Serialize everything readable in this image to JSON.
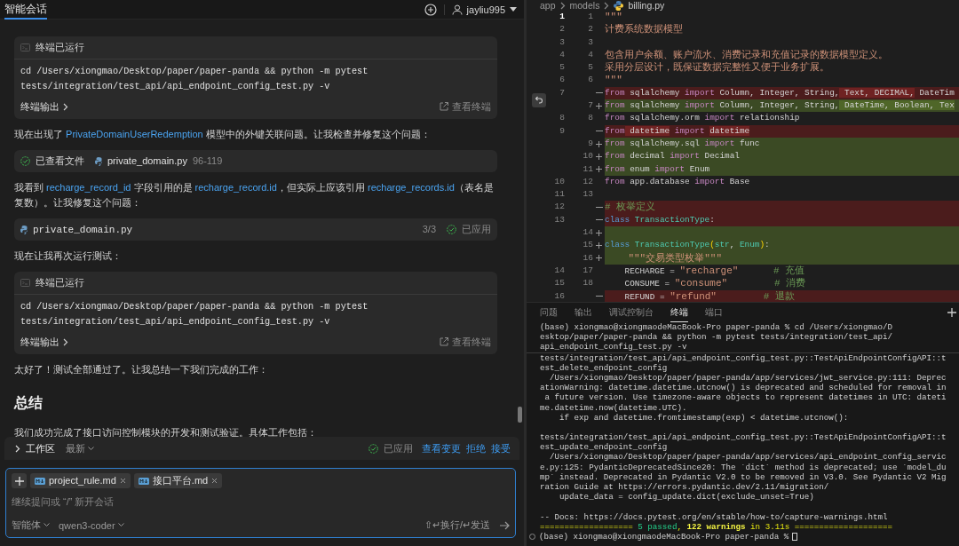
{
  "chat": {
    "title": "智能会话",
    "user": "jayliu995",
    "messages": [
      {
        "kind": "terminal",
        "status": "终端已运行",
        "command": "cd /Users/xiongmao/Desktop/paper/paper-panda && python -m pytest tests/integration/test_api/api_endpoint_config_test.py -v",
        "output_label": "终端输出",
        "open_label": "查看终端"
      },
      {
        "kind": "text",
        "segments": [
          {
            "kind": "text",
            "text": "现在出现了 "
          },
          {
            "kind": "link",
            "text": "PrivateDomainUserRedemption"
          },
          {
            "kind": "text",
            "text": " 模型中的外键关联问题。让我检查并修复这个问题："
          }
        ]
      },
      {
        "kind": "file_viewed",
        "status": "已查看文件",
        "file": "private_domain.py",
        "range": "96-119"
      },
      {
        "kind": "text",
        "segments": [
          {
            "kind": "text",
            "text": "我看到 "
          },
          {
            "kind": "link",
            "text": "recharge_record_id"
          },
          {
            "kind": "text",
            "text": " 字段引用的是 "
          },
          {
            "kind": "link",
            "text": "recharge_record.id"
          },
          {
            "kind": "text",
            "text": "，但实际上应该引用 "
          },
          {
            "kind": "link",
            "text": "recharge_records.id"
          },
          {
            "kind": "text",
            "text": "（表名是复数）。让我修复这个问题："
          }
        ]
      },
      {
        "kind": "file_edit",
        "file": "private_domain.py",
        "count": "3/3",
        "status": "已应用"
      },
      {
        "kind": "text",
        "segments": [
          {
            "kind": "text",
            "text": "现在让我再次运行测试："
          }
        ]
      },
      {
        "kind": "terminal",
        "status": "终端已运行",
        "command": "cd /Users/xiongmao/Desktop/paper/paper-panda && python -m pytest tests/integration/test_api/api_endpoint_config_test.py -v",
        "output_label": "终端输出",
        "open_label": "查看终端"
      },
      {
        "kind": "text",
        "segments": [
          {
            "kind": "text",
            "text": "太好了！测试全部通过了。让我总结一下我们完成的工作："
          }
        ]
      },
      {
        "kind": "heading",
        "text": "总结"
      },
      {
        "kind": "text",
        "segments": [
          {
            "kind": "text",
            "text": "我们成功完成了接口访问控制模块的开发和测试验证。具体工作包括："
          }
        ]
      }
    ],
    "workspace": {
      "label": "工作区",
      "version": "最新",
      "status": "已应用",
      "actions": [
        "查看变更",
        "拒绝",
        "接受"
      ]
    },
    "composer": {
      "attachments": [
        "project_rule.md",
        "接口平台.md"
      ],
      "placeholder": "继续提问或 “/” 新开会话",
      "mode": "智能体",
      "model": "qwen3-coder",
      "hint": "⇧↵换行/↵发送"
    }
  },
  "editor": {
    "breadcrumb": [
      "app",
      "models",
      "billing.py"
    ],
    "lines": [
      {
        "old": "1",
        "new": "1",
        "added": false,
        "removed": false,
        "current": true,
        "tokens": [
          {
            "kind": "string",
            "text": "\"\"\""
          }
        ]
      },
      {
        "old": "2",
        "new": "2",
        "added": false,
        "removed": false,
        "current": false,
        "tokens": [
          {
            "kind": "string",
            "text": "计费系统数据模型"
          }
        ]
      },
      {
        "old": "3",
        "new": "3",
        "added": false,
        "removed": false,
        "current": false
      },
      {
        "old": "4",
        "new": "4",
        "added": false,
        "removed": false,
        "current": false,
        "tokens": [
          {
            "kind": "string",
            "text": "包含用户余额、账户流水、消费记录和充值记录的数据模型定义。"
          }
        ]
      },
      {
        "old": "5",
        "new": "5",
        "added": false,
        "removed": false,
        "current": false,
        "tokens": [
          {
            "kind": "string",
            "text": "采用分层设计，既保证数据完整性又便于业务扩展。"
          }
        ]
      },
      {
        "old": "6",
        "new": "6",
        "added": false,
        "removed": false,
        "current": false,
        "tokens": [
          {
            "kind": "string",
            "text": "\"\"\""
          }
        ]
      },
      {
        "old": "7",
        "added": false,
        "removed": true,
        "current": false,
        "tokens": [
          {
            "kind": "keyword",
            "text": "from"
          },
          {
            "kind": "text",
            "text": " sqlalchemy "
          },
          {
            "kind": "keyword",
            "text": "import"
          },
          {
            "kind": "text",
            "text": " Column, Integer, String,"
          },
          {
            "kind": "text",
            "text": " Text, DECIMAL,",
            "changed": true
          },
          {
            "kind": "text",
            "text": " DateTim"
          }
        ]
      },
      {
        "new": "7",
        "added": true,
        "removed": false,
        "current": false,
        "tokens": [
          {
            "kind": "keyword",
            "text": "from"
          },
          {
            "kind": "text",
            "text": " sqlalchemy "
          },
          {
            "kind": "keyword",
            "text": "import"
          },
          {
            "kind": "text",
            "text": " Column, Integer, String,"
          },
          {
            "kind": "text",
            "text": " DateTime,",
            "changed": true
          },
          {
            "kind": "text",
            "text": " Boolean, Tex",
            "changed": true
          }
        ]
      },
      {
        "old": "8",
        "new": "8",
        "added": false,
        "removed": false,
        "current": false,
        "tokens": [
          {
            "kind": "keyword",
            "text": "from"
          },
          {
            "kind": "text",
            "text": " sqlalchemy.orm "
          },
          {
            "kind": "keyword",
            "text": "import"
          },
          {
            "kind": "text",
            "text": " relationship"
          }
        ]
      },
      {
        "old": "9",
        "added": false,
        "removed": true,
        "current": false,
        "tokens": [
          {
            "kind": "keyword",
            "text": "from"
          },
          {
            "kind": "text",
            "text": " datetime",
            "changed": true
          },
          {
            "kind": "keyword",
            "text": " import "
          },
          {
            "kind": "text",
            "text": "datetime",
            "changed": true
          }
        ]
      },
      {
        "new": "9",
        "added": true,
        "removed": false,
        "current": false,
        "tokens": [
          {
            "kind": "keyword",
            "text": "from"
          },
          {
            "kind": "text",
            "text": " sqlalchemy.sql "
          },
          {
            "kind": "keyword",
            "text": "import"
          },
          {
            "kind": "text",
            "text": " func"
          }
        ]
      },
      {
        "new": "10",
        "added": true,
        "removed": false,
        "current": false,
        "tokens": [
          {
            "kind": "keyword",
            "text": "from"
          },
          {
            "kind": "text",
            "text": " decimal "
          },
          {
            "kind": "keyword",
            "text": "import"
          },
          {
            "kind": "text",
            "text": " Decimal"
          }
        ]
      },
      {
        "new": "11",
        "added": true,
        "removed": false,
        "current": false,
        "tokens": [
          {
            "kind": "keyword",
            "text": "from"
          },
          {
            "kind": "text",
            "text": " enum "
          },
          {
            "kind": "keyword",
            "text": "import"
          },
          {
            "kind": "text",
            "text": " Enum"
          }
        ]
      },
      {
        "old": "10",
        "new": "12",
        "added": false,
        "removed": false,
        "current": false,
        "tokens": [
          {
            "kind": "keyword",
            "text": "from"
          },
          {
            "kind": "text",
            "text": " app.database "
          },
          {
            "kind": "keyword",
            "text": "import"
          },
          {
            "kind": "text",
            "text": " Base"
          }
        ]
      },
      {
        "old": "11",
        "new": "13",
        "added": false,
        "removed": false,
        "current": false
      },
      {
        "old": "12",
        "added": false,
        "removed": true,
        "current": false,
        "tokens": [
          {
            "kind": "comment",
            "text": "# 枚举定义"
          }
        ]
      },
      {
        "old": "13",
        "added": false,
        "removed": true,
        "current": false,
        "tokens": [
          {
            "kind": "storage",
            "text": "class "
          },
          {
            "kind": "type",
            "text": "TransactionType"
          },
          {
            "kind": "text",
            "text": ":"
          }
        ]
      },
      {
        "new": "14",
        "added": true,
        "removed": false,
        "current": false
      },
      {
        "new": "15",
        "added": true,
        "removed": false,
        "current": false,
        "tokens": [
          {
            "kind": "storage",
            "text": "class "
          },
          {
            "kind": "type",
            "text": "TransactionType"
          },
          {
            "kind": "bracket",
            "text": "("
          },
          {
            "kind": "type",
            "text": "str"
          },
          {
            "kind": "text",
            "text": ", "
          },
          {
            "kind": "type",
            "text": "Enum"
          },
          {
            "kind": "bracket",
            "text": ")"
          },
          {
            "kind": "text",
            "text": ":"
          }
        ]
      },
      {
        "new": "16",
        "added": true,
        "removed": false,
        "current": false,
        "tokens": [
          {
            "kind": "string",
            "text": "    \"\"\"交易类型枚举\"\"\""
          }
        ]
      },
      {
        "old": "14",
        "new": "17",
        "added": false,
        "removed": false,
        "current": false,
        "tokens": [
          {
            "kind": "text",
            "text": "    RECHARGE = "
          },
          {
            "kind": "string",
            "text": "\"recharge\"      "
          },
          {
            "kind": "comment",
            "text": "# 充值"
          }
        ]
      },
      {
        "old": "15",
        "new": "18",
        "added": false,
        "removed": false,
        "current": false,
        "tokens": [
          {
            "kind": "text",
            "text": "    CONSUME = "
          },
          {
            "kind": "string",
            "text": "\"consume\"        "
          },
          {
            "kind": "comment",
            "text": "# 消费"
          }
        ]
      },
      {
        "old": "16",
        "added": false,
        "removed": true,
        "current": false,
        "tokens": [
          {
            "kind": "text",
            "text": "    REFUND = "
          },
          {
            "kind": "string",
            "text": "\"refund\"        "
          },
          {
            "kind": "comment",
            "text": "# 退款"
          }
        ]
      }
    ]
  },
  "terminal": {
    "tabs": [
      {
        "label": "问题",
        "selected": false
      },
      {
        "label": "输出",
        "selected": false
      },
      {
        "label": "调试控制台",
        "selected": false
      },
      {
        "label": "终端",
        "selected": true
      },
      {
        "label": "端口",
        "selected": false
      }
    ],
    "lines": [
      {
        "kind": "command",
        "text": "(base) xiongmao@xiongmaodeMacBook-Pro paper-panda % cd /Users/xiongmao/D"
      },
      {
        "kind": "command",
        "text": "esktop/paper/paper-panda && python -m pytest tests/integration/test_api/"
      },
      {
        "kind": "command",
        "text": "api_endpoint_config_test.py -v"
      },
      {
        "kind": "output",
        "text": "tests/integration/test_api/api_endpoint_config_test.py::TestApiEndpointConfigAPI::t"
      },
      {
        "kind": "output",
        "text": "est_delete_endpoint_config"
      },
      {
        "kind": "output",
        "text": "  /Users/xiongmao/Desktop/paper/paper-panda/app/services/jwt_service.py:111: Deprec"
      },
      {
        "kind": "output",
        "text": "ationWarning: datetime.datetime.utcnow() is deprecated and scheduled for removal in"
      },
      {
        "kind": "output",
        "text": " a future version. Use timezone-aware objects to represent datetimes in UTC: dateti"
      },
      {
        "kind": "output",
        "text": "me.datetime.now(datetime.UTC)."
      },
      {
        "kind": "output",
        "text": "    if exp and datetime.fromtimestamp(exp) < datetime.utcnow():"
      },
      {
        "kind": "blank"
      },
      {
        "kind": "output",
        "text": "tests/integration/test_api/api_endpoint_config_test.py::TestApiEndpointConfigAPI::t"
      },
      {
        "kind": "output",
        "text": "est_update_endpoint_config"
      },
      {
        "kind": "output",
        "text": "  /Users/xiongmao/Desktop/paper/paper-panda/app/services/api_endpoint_config_servic"
      },
      {
        "kind": "output",
        "text": "e.py:125: PydanticDeprecatedSince20: The `dict` method is deprecated; use `model_du"
      },
      {
        "kind": "output",
        "text": "mp` instead. Deprecated in Pydantic V2.0 to be removed in V3.0. See Pydantic V2 Mig"
      },
      {
        "kind": "output",
        "text": "ration Guide at https://errors.pydantic.dev/2.11/migration/"
      },
      {
        "kind": "output",
        "text": "    update_data = config_update.dict(exclude_unset=True)"
      },
      {
        "kind": "blank"
      },
      {
        "kind": "output",
        "text": "-- Docs: https://docs.pytest.org/en/stable/how-to/capture-warnings.html"
      },
      {
        "kind": "summary",
        "segments": [
          {
            "kind": "warning",
            "text": "=================== "
          },
          {
            "kind": "passed",
            "text": "5 passed"
          },
          {
            "kind": "warning",
            "text": ", "
          },
          {
            "kind": "count",
            "text": "122 warnings"
          },
          {
            "kind": "warning",
            "text": " in 3.11s"
          },
          {
            "kind": "warning",
            "text": " ===================="
          }
        ]
      },
      {
        "kind": "prompt",
        "text": "(base) xiongmao@xiongmaodeMacBook-Pro paper-panda %"
      }
    ]
  }
}
